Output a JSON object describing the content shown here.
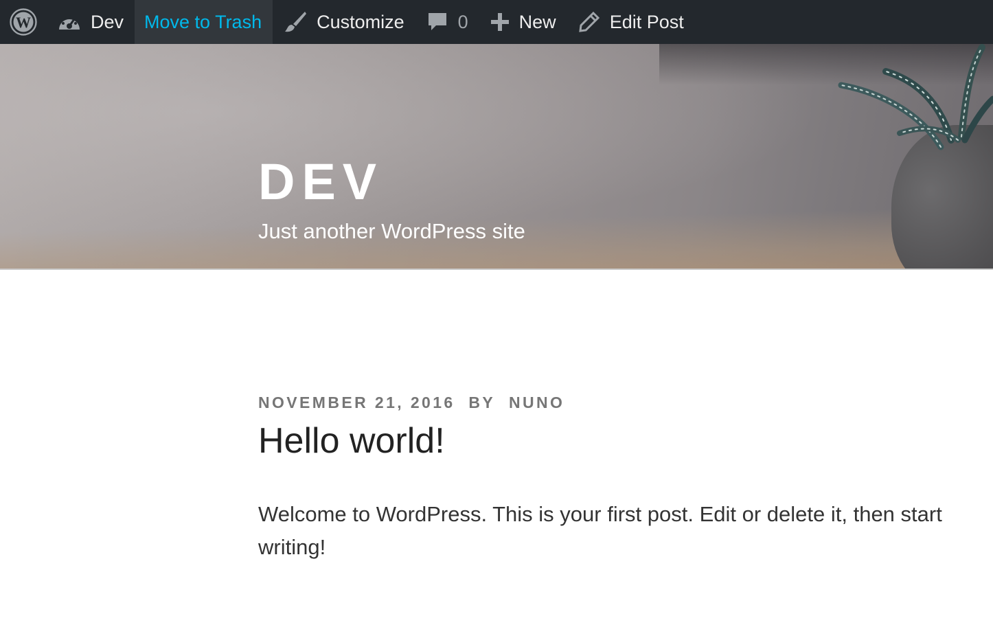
{
  "admin_bar": {
    "wp_logo_icon": "wordpress-logo-icon",
    "site_name": "Dev",
    "site_icon": "dashboard-gauge-icon",
    "trash_label": "Move to Trash",
    "customize_label": "Customize",
    "customize_icon": "paintbrush-icon",
    "comments_count": "0",
    "comments_icon": "comment-bubble-icon",
    "new_label": "New",
    "new_icon": "plus-icon",
    "edit_label": "Edit Post",
    "edit_icon": "pencil-icon",
    "colors": {
      "background": "#23282d",
      "text": "#eeeeee",
      "highlight_bg": "#32373c",
      "highlight_text": "#00b9eb",
      "icon": "#a0a5aa"
    }
  },
  "header": {
    "site_title": "DEV",
    "site_description": "Just another WordPress site"
  },
  "post": {
    "date": "November 21, 2016",
    "by": "by",
    "author": "Nuno",
    "title": "Hello world!",
    "content": "Welcome to WordPress. This is your first post. Edit or delete it, then start writing!"
  }
}
